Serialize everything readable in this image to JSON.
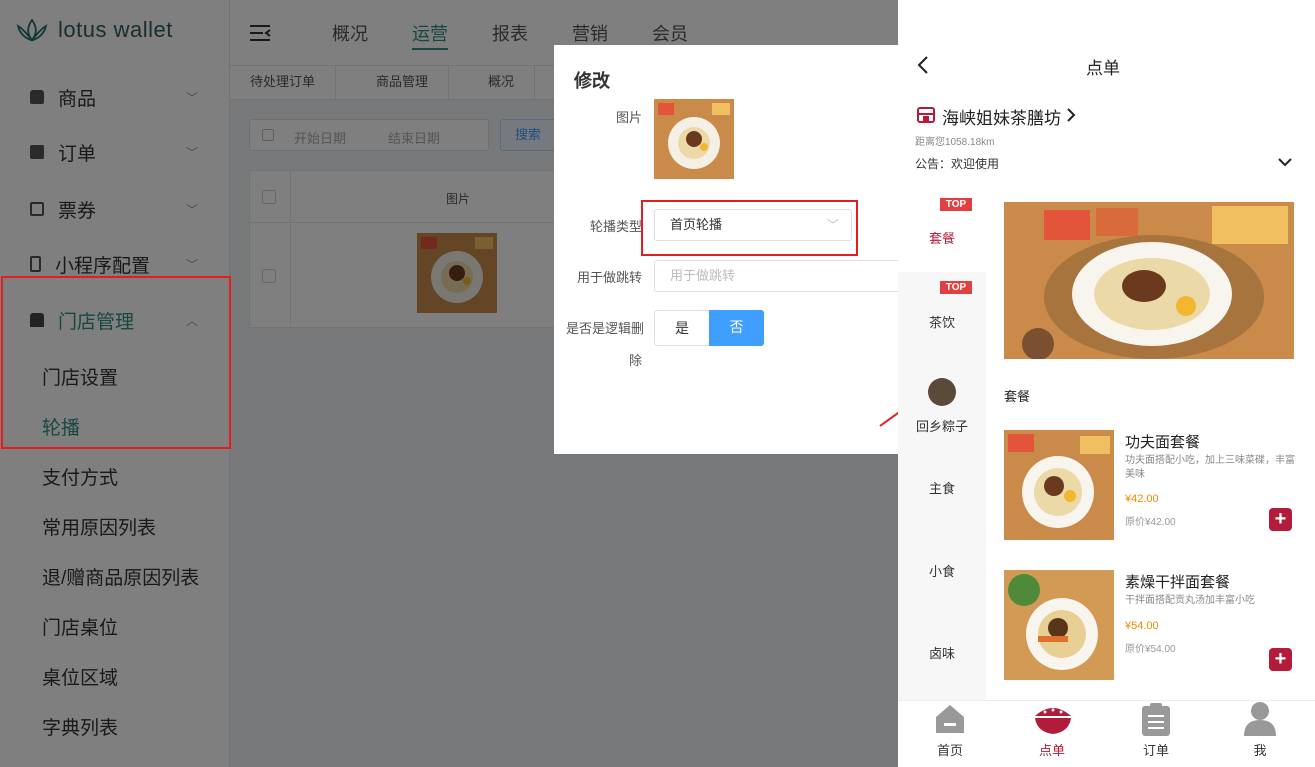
{
  "app": {
    "logo_text": "lotus wallet"
  },
  "sidebar": {
    "items": [
      {
        "label": "商品",
        "chev": "﹀"
      },
      {
        "label": "订单",
        "chev": "﹀"
      },
      {
        "label": "票券",
        "chev": "﹀"
      },
      {
        "label": "小程序配置",
        "chev": "﹀"
      },
      {
        "label": "门店管理",
        "chev": "︿"
      }
    ],
    "sub_items": [
      "门店设置",
      "轮播",
      "支付方式",
      "常用原因列表",
      "退/赠商品原因列表",
      "门店桌位",
      "桌位区域",
      "字典列表"
    ],
    "active_color": "#2f8f83"
  },
  "topnav": {
    "items": [
      "概况",
      "运营",
      "报表",
      "营销",
      "会员"
    ],
    "active": "运营"
  },
  "tabs": [
    "待处理订单",
    "商品管理",
    "概况"
  ],
  "filter": {
    "start_placeholder": "开始日期",
    "end_placeholder": "结束日期",
    "search_label": "搜索"
  },
  "table": {
    "col_image": "图片"
  },
  "dialog": {
    "title": "修改",
    "label_image": "图片",
    "label_type": "轮播类型",
    "type_value": "首页轮播",
    "label_jump": "用于做跳转",
    "jump_placeholder": "用于做跳转",
    "label_delete_1": "是否是逻辑删",
    "label_delete_2": "除",
    "yes": "是",
    "no": "否"
  },
  "phone": {
    "header_title": "点单",
    "store_name": "海峡姐妹茶膳坊",
    "distance": "距离您1058.18km",
    "notice": "公告：欢迎使用",
    "categories": [
      {
        "name": "套餐",
        "badge": "TOP"
      },
      {
        "name": "茶饮",
        "badge": "TOP"
      },
      {
        "name": "回乡粽子",
        "badge": ""
      },
      {
        "name": "主食",
        "badge": ""
      },
      {
        "name": "小食",
        "badge": ""
      },
      {
        "name": "卤味",
        "badge": ""
      }
    ],
    "section_title": "套餐",
    "products": [
      {
        "name": "功夫面套餐",
        "desc": "功夫面搭配小吃，加上三味菜碟，丰富美味",
        "price": "¥42.00",
        "orig": "原价¥42.00"
      },
      {
        "name": "素燥干拌面套餐",
        "desc": "干拌面搭配贡丸汤加丰富小吃",
        "price": "¥54.00",
        "orig": "原价¥54.00"
      }
    ],
    "tabbar": [
      {
        "label": "首页",
        "icon": "home-icon"
      },
      {
        "label": "点单",
        "icon": "bowl-icon"
      },
      {
        "label": "订单",
        "icon": "clipboard-icon"
      },
      {
        "label": "我",
        "icon": "user-icon"
      }
    ],
    "accent": "#b21c3a"
  }
}
